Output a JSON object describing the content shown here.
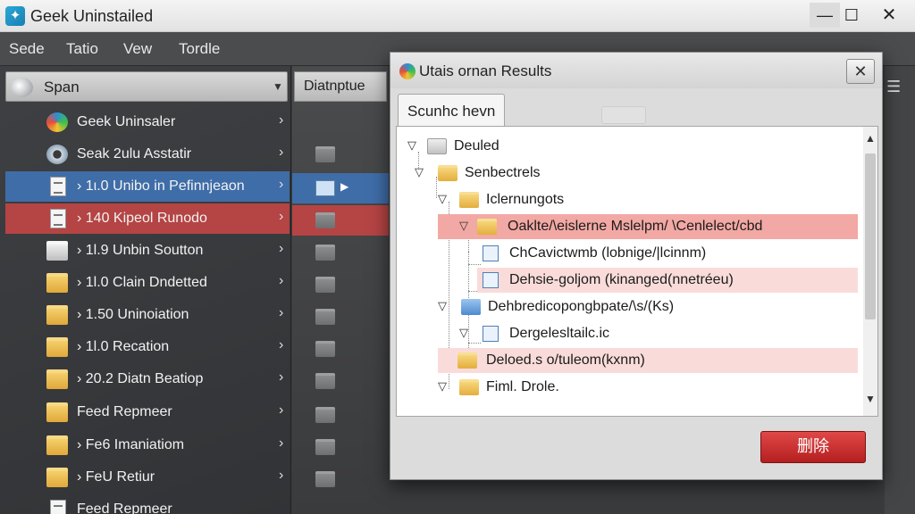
{
  "app": {
    "title": "Geek Uninstailed",
    "icon": "geek-uninstaller-icon",
    "window_controls": {
      "minimize": "—",
      "maximize": "☐",
      "close": "✕"
    }
  },
  "menu": [
    {
      "label": "Sede"
    },
    {
      "label": "Tatio"
    },
    {
      "label": "Vew"
    },
    {
      "label": "Tordle"
    }
  ],
  "left_pane": {
    "header_label": "Span",
    "items": [
      {
        "label": "Geek Uninsaler",
        "icon": "globe-icon",
        "state": "normal"
      },
      {
        "label": "Seak 2ulu Asstatir",
        "icon": "gear-icon",
        "state": "normal"
      },
      {
        "label": "› 1ι.0 Unibo in Pefinnjeaon",
        "icon": "document-icon",
        "state": "selected"
      },
      {
        "label": "› 140 Kipeol Runodo",
        "icon": "document-icon",
        "state": "danger"
      },
      {
        "label": "› 1l.9 Unbin Soutton",
        "icon": "folder-icon",
        "state": "normal"
      },
      {
        "label": "› 1l.0 Clain Dndetted",
        "icon": "folder-icon",
        "state": "normal"
      },
      {
        "label": "› 1.50 Uninoiation",
        "icon": "folder-icon",
        "state": "normal"
      },
      {
        "label": "› 1l.0 Recation",
        "icon": "folder-icon",
        "state": "normal"
      },
      {
        "label": "› 20.2 Diatn Beatiop",
        "icon": "folder-icon",
        "state": "normal"
      },
      {
        "label": "Feed Repmeer",
        "icon": "folder-icon",
        "state": "normal"
      },
      {
        "label": "› Fe6 Imaniatiom",
        "icon": "folder-icon",
        "state": "normal"
      },
      {
        "label": "› FeU Retiur",
        "icon": "folder-icon",
        "state": "normal"
      },
      {
        "label": "Feed Repmeer",
        "icon": "document-icon",
        "state": "normal"
      }
    ]
  },
  "mid_pane": {
    "header_label": "Diatnptue"
  },
  "dialog": {
    "title": "Utais ornan Results",
    "tab_label": "Scunhc hevn",
    "tree": [
      {
        "label": "Deuled",
        "icon": "gray-folder",
        "level": 0,
        "highlight": "none"
      },
      {
        "label": "Senbectrels",
        "icon": "folder",
        "level": 1,
        "highlight": "none"
      },
      {
        "label": "Iclernungots",
        "icon": "folder",
        "level": 2,
        "highlight": "none"
      },
      {
        "label": "Oaklte/\\eislerne Mslelpm/ \\Cenlelect/cbd",
        "icon": "folder",
        "level": 3,
        "highlight": "strong"
      },
      {
        "label": "ChCavictwmb (lobnige/|lcinnm)",
        "icon": "doc",
        "level": 4,
        "highlight": "none"
      },
      {
        "label": "Dehsie-goljom (kinanged(nnetréeu)",
        "icon": "doc",
        "level": 4,
        "highlight": "soft"
      },
      {
        "label": "Dehbredicopongbpate/\\s/(Ks)",
        "icon": "blue-folder",
        "level": 2,
        "highlight": "none"
      },
      {
        "label": "Dergelesltailc.ic",
        "icon": "doc",
        "level": 3,
        "highlight": "none"
      },
      {
        "label": "Deloed.s o/tuleom(kxnm)",
        "icon": "folder",
        "level": 2,
        "highlight": "soft"
      },
      {
        "label": "Fiml. Drole.",
        "icon": "folder",
        "level": 2,
        "highlight": "none"
      }
    ],
    "delete_button": "删除",
    "close_symbol": "✕"
  },
  "colors": {
    "selected_row": "#3f6da8",
    "danger_row": "#b54444",
    "tree_highlight_strong": "#f2a8a4",
    "tree_highlight_soft": "#f9dcda",
    "delete_button": "#c62a2a"
  }
}
